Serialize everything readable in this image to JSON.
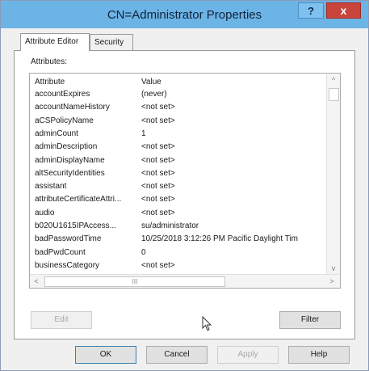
{
  "window": {
    "title": "CN=Administrator Properties"
  },
  "titlebar": {
    "help_label": "?",
    "close_label": "x"
  },
  "tabs": [
    {
      "label": "Attribute Editor",
      "active": true
    },
    {
      "label": "Security",
      "active": false
    }
  ],
  "attributes": {
    "label": "Attributes:",
    "columns": [
      "Attribute",
      "Value"
    ],
    "rows": [
      {
        "name": "accountExpires",
        "value": "(never)"
      },
      {
        "name": "accountNameHistory",
        "value": "<not set>"
      },
      {
        "name": "aCSPolicyName",
        "value": "<not set>"
      },
      {
        "name": "adminCount",
        "value": "1"
      },
      {
        "name": "adminDescription",
        "value": "<not set>"
      },
      {
        "name": "adminDisplayName",
        "value": "<not set>"
      },
      {
        "name": "altSecurityIdentities",
        "value": "<not set>"
      },
      {
        "name": "assistant",
        "value": "<not set>"
      },
      {
        "name": "attributeCertificateAttri...",
        "value": "<not set>"
      },
      {
        "name": "audio",
        "value": "<not set>"
      },
      {
        "name": "b020U1615IPAccess...",
        "value": "su/administrator"
      },
      {
        "name": "badPasswordTime",
        "value": "10/25/2018 3:12:26 PM Pacific Daylight Tim"
      },
      {
        "name": "badPwdCount",
        "value": "0"
      },
      {
        "name": "businessCategory",
        "value": "<not set>"
      }
    ],
    "hscroll_thumb": "III"
  },
  "buttons": {
    "edit": "Edit",
    "filter": "Filter",
    "ok": "OK",
    "cancel": "Cancel",
    "apply": "Apply",
    "help": "Help"
  }
}
